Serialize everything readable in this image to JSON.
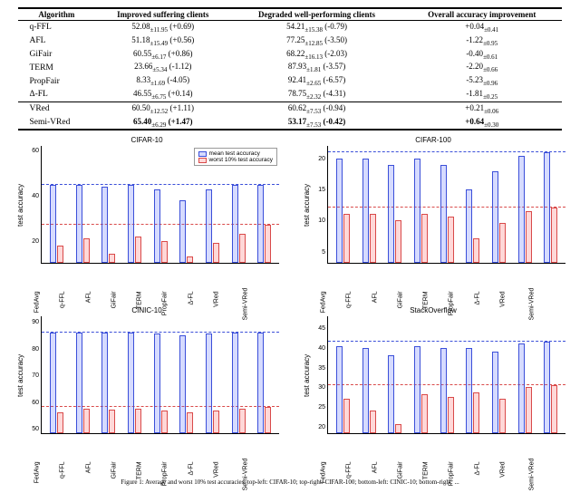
{
  "table": {
    "headers": [
      "Algorithm",
      "Improved suffering clients",
      "Degraded well-performing clients",
      "Overall accuracy improvement"
    ],
    "group1": [
      {
        "alg": "q-FFL",
        "c1_main": "52.08",
        "c1_sub": "±11.95",
        "c1_par": "(+0.69)",
        "c2_main": "54.21",
        "c2_sub": "±15.38",
        "c2_par": "(-0.79)",
        "c3_main": "+0.04",
        "c3_sub": "±0.41"
      },
      {
        "alg": "AFL",
        "c1_main": "51.18",
        "c1_sub": "±15.49",
        "c1_par": "(+0.56)",
        "c2_main": "77.25",
        "c2_sub": "±12.85",
        "c2_par": "(-3.50)",
        "c3_main": "-1.22",
        "c3_sub": "±0.95"
      },
      {
        "alg": "GiFair",
        "c1_main": "60.55",
        "c1_sub": "±6.17",
        "c1_par": "(+0.86)",
        "c2_main": "68.22",
        "c2_sub": "±16.13",
        "c2_par": "(-2.03)",
        "c3_main": "-0.40",
        "c3_sub": "±0.61"
      },
      {
        "alg": "TERM",
        "c1_main": "23.66",
        "c1_sub": "±5.34",
        "c1_par": "(-1.12)",
        "c2_main": "87.93",
        "c2_sub": "±1.81",
        "c2_par": "(-3.57)",
        "c3_main": "-2.20",
        "c3_sub": "±0.66"
      },
      {
        "alg": "PropFair",
        "c1_main": "8.33",
        "c1_sub": "±1.69",
        "c1_par": "(-4.05)",
        "c2_main": "92.41",
        "c2_sub": "±2.65",
        "c2_par": "(-6.57)",
        "c3_main": "-5.23",
        "c3_sub": "±0.96"
      },
      {
        "alg": "Δ-FL",
        "c1_main": "46.55",
        "c1_sub": "±6.75",
        "c1_par": "(+0.14)",
        "c2_main": "78.75",
        "c2_sub": "±2.32",
        "c2_par": "(-4.31)",
        "c3_main": "-1.81",
        "c3_sub": "±0.25"
      }
    ],
    "group2": [
      {
        "alg": "VRed",
        "c1_main": "60.50",
        "c1_sub": "±12.52",
        "c1_par": "(+1.11)",
        "c2_main": "60.62",
        "c2_sub": "±7.53",
        "c2_par": "(-0.94)",
        "c3_main": "+0.21",
        "c3_sub": "±0.06"
      },
      {
        "alg": "Semi-VRed",
        "c1_main": "65.40",
        "c1_sub": "±6.29",
        "c1_par": "(+1.47)",
        "c2_main": "53.17",
        "c2_sub": "±7.53",
        "c2_par": "(-0.42)",
        "c3_main": "+0.64",
        "c3_sub": "±0.30",
        "bold": true
      }
    ]
  },
  "legend": {
    "mean": "mean test accuracy",
    "worst": "worst 10% test accuracy"
  },
  "ylabel": "test accuracy",
  "algorithms": [
    "FedAvg",
    "q-FFL",
    "AFL",
    "GiFair",
    "TERM",
    "PropFair",
    "Δ-FL",
    "VRed",
    "Semi-VRed"
  ],
  "caption": "Figure 1: Average and worst 10% test accuracies. top-left: CIFAR-10; top-right: CIFAR-100; bottom-left: CINIC-10; bottom-right: ...",
  "chart_data": [
    {
      "type": "bar",
      "title": "CIFAR-10",
      "xlabel": "",
      "ylabel": "test accuracy",
      "ylim": [
        10,
        62
      ],
      "yticks": [
        20,
        40,
        60
      ],
      "show_legend": true,
      "categories": [
        "FedAvg",
        "q-FFL",
        "AFL",
        "GiFair",
        "TERM",
        "PropFair",
        "Δ-FL",
        "VRed",
        "Semi-VRed"
      ],
      "series": [
        {
          "name": "mean test accuracy",
          "color": "#7a88ff",
          "values": [
            45,
            45,
            44,
            45,
            43,
            38,
            43,
            45,
            45
          ]
        },
        {
          "name": "worst 10% test accuracy",
          "color": "#ff9d9d",
          "values": [
            18,
            21,
            14,
            22,
            20,
            13,
            19,
            23,
            27
          ]
        }
      ],
      "ref_lines": [
        {
          "series": 0,
          "value": 45
        },
        {
          "series": 1,
          "value": 27
        }
      ],
      "grid": false,
      "legend_pos": "upper right"
    },
    {
      "type": "bar",
      "title": "CIFAR-100",
      "xlabel": "",
      "ylabel": "test accuracy",
      "ylim": [
        3,
        22
      ],
      "yticks": [
        5,
        10,
        15,
        20
      ],
      "show_legend": false,
      "categories": [
        "FedAvg",
        "q-FFL",
        "AFL",
        "GiFair",
        "TERM",
        "PropFair",
        "Δ-FL",
        "VRed",
        "Semi-VRed"
      ],
      "series": [
        {
          "name": "mean test accuracy",
          "color": "#7a88ff",
          "values": [
            20,
            20,
            19,
            20,
            19,
            15,
            18,
            20.5,
            21
          ]
        },
        {
          "name": "worst 10% test accuracy",
          "color": "#ff9d9d",
          "values": [
            11,
            11,
            10,
            11,
            10.5,
            7,
            9.5,
            11.5,
            12
          ]
        }
      ],
      "ref_lines": [
        {
          "series": 0,
          "value": 21
        },
        {
          "series": 1,
          "value": 12
        }
      ],
      "grid": false
    },
    {
      "type": "bar",
      "title": "CINIC-10",
      "xlabel": "",
      "ylabel": "test accuracy",
      "ylim": [
        48,
        92
      ],
      "yticks": [
        50,
        60,
        70,
        80,
        90
      ],
      "show_legend": false,
      "categories": [
        "FedAvg",
        "q-FFL",
        "AFL",
        "GiFair",
        "TERM",
        "PropFair",
        "Δ-FL",
        "VRed",
        "Semi-VRed"
      ],
      "series": [
        {
          "name": "mean test accuracy",
          "color": "#7a88ff",
          "values": [
            86,
            86,
            86,
            86,
            85.5,
            85,
            85.5,
            86,
            86
          ]
        },
        {
          "name": "worst 10% test accuracy",
          "color": "#ff9d9d",
          "values": [
            56,
            57.5,
            57,
            57.5,
            56.5,
            56,
            56.5,
            57.5,
            58
          ]
        }
      ],
      "ref_lines": [
        {
          "series": 0,
          "value": 86
        },
        {
          "series": 1,
          "value": 58
        }
      ],
      "grid": false
    },
    {
      "type": "bar",
      "title": "StackOverflow",
      "xlabel": "",
      "ylabel": "test accuracy",
      "ylim": [
        18,
        48
      ],
      "yticks": [
        20,
        25,
        30,
        35,
        40,
        45
      ],
      "show_legend": false,
      "categories": [
        "FedAvg",
        "q-FFL",
        "AFL",
        "GiFair",
        "TERM",
        "PropFair",
        "Δ-FL",
        "VRed",
        "Semi-VRed"
      ],
      "series": [
        {
          "name": "mean test accuracy",
          "color": "#7a88ff",
          "values": [
            40.5,
            40,
            38,
            40.5,
            40,
            40,
            39,
            41,
            41.5
          ]
        },
        {
          "name": "worst 10% test accuracy",
          "color": "#ff9d9d",
          "values": [
            27,
            24,
            20.5,
            28,
            27.5,
            28.5,
            27,
            30,
            30.5
          ]
        }
      ],
      "ref_lines": [
        {
          "series": 0,
          "value": 41.5
        },
        {
          "series": 1,
          "value": 30.5
        }
      ],
      "grid": false
    }
  ]
}
